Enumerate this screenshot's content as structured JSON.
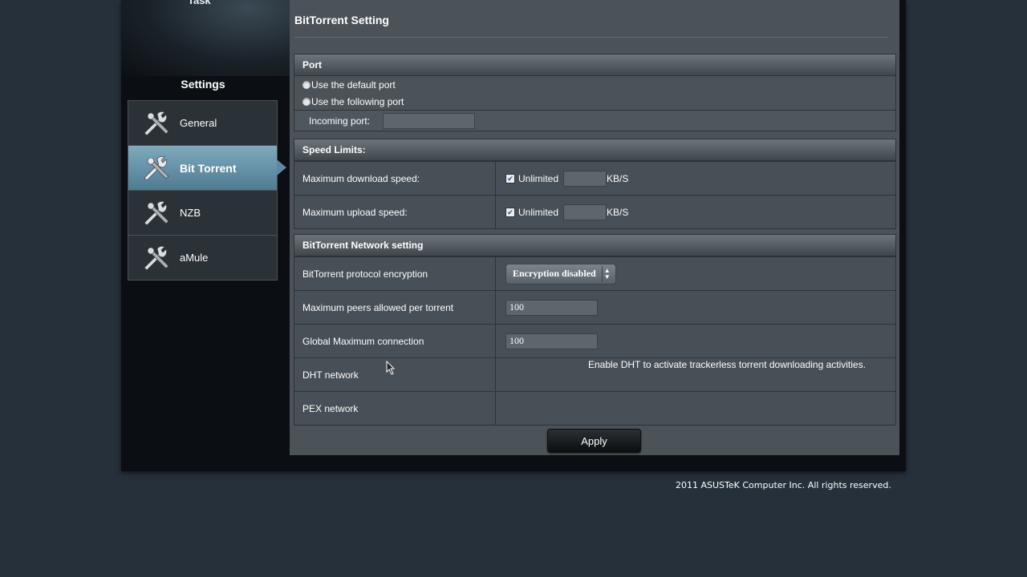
{
  "sidebar": {
    "task_label": "Task",
    "settings_title": "Settings",
    "items": [
      {
        "label": "General",
        "icon": "tools-icon",
        "active": false
      },
      {
        "label": "Bit Torrent",
        "icon": "tools-icon",
        "active": true
      },
      {
        "label": "NZB",
        "icon": "tools-icon",
        "active": false
      },
      {
        "label": "aMule",
        "icon": "tools-icon",
        "active": false
      }
    ]
  },
  "main": {
    "title": "BitTorrent Setting",
    "port": {
      "heading": "Port",
      "option_default": "Use the default port",
      "option_following": "Use the following port",
      "incoming_label": "Incoming port:",
      "incoming_value": ""
    },
    "speed": {
      "heading": "Speed Limits:",
      "download_label": "Maximum download speed:",
      "upload_label": "Maximum upload speed:",
      "unlimited_label": "Unlimited",
      "download_unlimited": true,
      "upload_unlimited": true,
      "download_value": "",
      "upload_value": "",
      "unit": "KB/S"
    },
    "network": {
      "heading": "BitTorrent Network setting",
      "encryption_label": "BitTorrent protocol encryption",
      "encryption_value": "Encryption disabled",
      "peers_label": "Maximum peers allowed per torrent",
      "peers_value": "100",
      "global_label": "Global Maximum connection",
      "global_value": "100",
      "dht_label": "DHT network",
      "dht_note": "Enable DHT to activate trackerless torrent downloading activities.",
      "pex_label": "PEX network"
    },
    "apply_label": "Apply"
  },
  "footer": {
    "copyright": "2011 ASUSTeK Computer Inc. All rights reserved."
  },
  "colors": {
    "page_bg": "#26303a",
    "panel_bg": "#4b5359",
    "active_tab": "#6f9cb1"
  }
}
